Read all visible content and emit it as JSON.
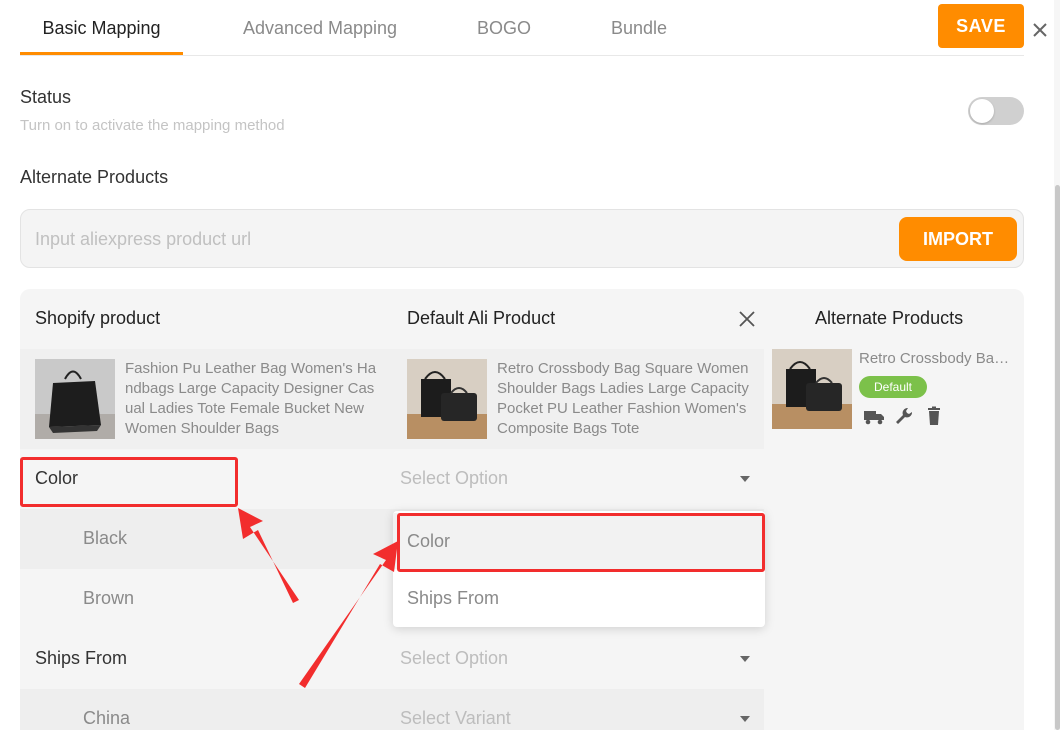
{
  "tabs": [
    {
      "label": "Basic Mapping",
      "active": true
    },
    {
      "label": "Advanced Mapping",
      "active": false
    },
    {
      "label": "BOGO",
      "active": false
    },
    {
      "label": "Bundle",
      "active": false
    }
  ],
  "save_label": "SAVE",
  "status": {
    "title": "Status",
    "description": "Turn on to activate the mapping method",
    "enabled": false
  },
  "alternate_section_title": "Alternate Products",
  "import": {
    "placeholder": "Input aliexpress product url",
    "button_label": "IMPORT"
  },
  "headers": {
    "shopify": "Shopify product",
    "default_ali": "Default Ali Product",
    "alternate": "Alternate Products"
  },
  "shopify_product": {
    "title": "Fashion Pu Leather Bag Women's Handbags Large Capacity Designer Casual Ladies Tote Female Bucket New Women Shoulder Bags"
  },
  "default_ali_product": {
    "title": "Retro Crossbody Bag Square Women Shoulder Bags Ladies Large Capacity Pocket PU Leather Fashion Women's Composite Bags Tote"
  },
  "alternate_product": {
    "title": "Retro Crossbody Bag Square Women Shoulder Bags",
    "badge": "Default",
    "icons": [
      "truck-icon",
      "wrench-icon",
      "trash-icon"
    ]
  },
  "options": [
    {
      "name": "Color",
      "select_placeholder": "Select Option",
      "values": [
        "Black",
        "Brown"
      ]
    },
    {
      "name": "Ships From",
      "select_placeholder": "Select Option",
      "values": [
        "China"
      ]
    }
  ],
  "variant_placeholder": "Select Variant",
  "dropdown": {
    "items": [
      "Color",
      "Ships From"
    ],
    "hovered": "Color"
  },
  "colors": {
    "accent": "#ff8c00",
    "badge": "#7cc14a",
    "annotation": "#f22d2d"
  }
}
